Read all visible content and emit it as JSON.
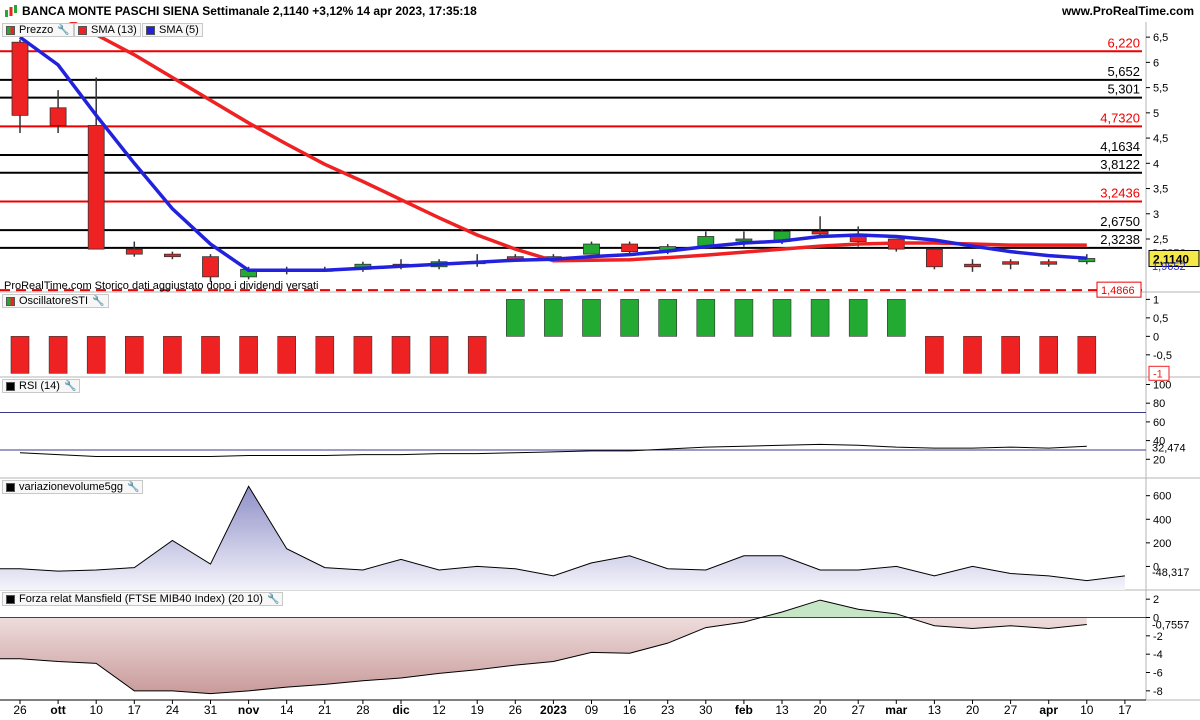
{
  "header": {
    "title": "BANCA MONTE PASCHI SIENA Settimanale 2,1140 +3,12% 14 apr 2023, 17:35:18",
    "site": "www.ProRealTime.com"
  },
  "legend_price": {
    "price_label": "Prezzo",
    "sma13_label": "SMA (13)",
    "sma5_label": "SMA (5)"
  },
  "note": "ProRealTime.com  Storico dati aggiustato dopo i dividendi versati",
  "colors": {
    "up": "#22aa33",
    "down": "#ee2222",
    "sma13": "#ee2222",
    "sma5": "#2222dd",
    "level_red": "#ee0000",
    "level_black": "#000000",
    "rsi_line": "#000000",
    "vol_fill": "#c9c9e6",
    "mansfield_pos": "#c6e6c6",
    "mansfield_neg": "#e8c8c8"
  },
  "chart_data": [
    {
      "type": "candlestick",
      "panel": "price",
      "x": [
        "26",
        "ott",
        "10",
        "17",
        "24",
        "31",
        "nov",
        "14",
        "21",
        "28",
        "dic",
        "12",
        "19",
        "26",
        "2023",
        "09",
        "16",
        "23",
        "30",
        "feb",
        "13",
        "20",
        "27",
        "mar",
        "13",
        "20",
        "27",
        "apr",
        "10",
        "17"
      ],
      "ohlc": [
        [
          6.4,
          6.45,
          4.6,
          4.95
        ],
        [
          5.1,
          5.45,
          4.6,
          4.75
        ],
        [
          4.75,
          5.7,
          2.3,
          2.3
        ],
        [
          2.3,
          2.45,
          2.15,
          2.2
        ],
        [
          2.2,
          2.25,
          2.1,
          2.15
        ],
        [
          2.15,
          2.2,
          1.65,
          1.75
        ],
        [
          1.75,
          1.95,
          1.7,
          1.9
        ],
        [
          1.9,
          1.95,
          1.8,
          1.9
        ],
        [
          1.9,
          1.95,
          1.85,
          1.9
        ],
        [
          1.9,
          2.05,
          1.85,
          2.0
        ],
        [
          2.0,
          2.1,
          1.9,
          1.95
        ],
        [
          1.95,
          2.1,
          1.9,
          2.05
        ],
        [
          2.05,
          2.2,
          1.95,
          2.05
        ],
        [
          2.15,
          2.2,
          2.05,
          2.1
        ],
        [
          2.1,
          2.2,
          2.05,
          2.15
        ],
        [
          2.2,
          2.45,
          2.2,
          2.4
        ],
        [
          2.4,
          2.45,
          2.2,
          2.25
        ],
        [
          2.25,
          2.4,
          2.2,
          2.35
        ],
        [
          2.35,
          2.65,
          2.3,
          2.55
        ],
        [
          2.5,
          2.65,
          2.35,
          2.5
        ],
        [
          2.45,
          2.7,
          2.4,
          2.65
        ],
        [
          2.65,
          2.95,
          2.55,
          2.6
        ],
        [
          2.6,
          2.75,
          2.35,
          2.45
        ],
        [
          2.5,
          2.5,
          2.25,
          2.3
        ],
        [
          2.3,
          2.3,
          1.9,
          1.95
        ],
        [
          2.0,
          2.1,
          1.85,
          1.95
        ],
        [
          2.05,
          2.1,
          1.9,
          2.0
        ],
        [
          2.05,
          2.1,
          1.95,
          2.0
        ],
        [
          2.05,
          2.2,
          2.0,
          2.114
        ],
        null
      ],
      "sma13": [
        7.4,
        6.95,
        6.55,
        6.15,
        5.7,
        5.25,
        4.8,
        4.38,
        3.98,
        3.64,
        3.28,
        2.92,
        2.58,
        2.3,
        2.07,
        2.08,
        2.09,
        2.13,
        2.18,
        2.24,
        2.3,
        2.36,
        2.4,
        2.42,
        2.42,
        2.4,
        2.38,
        2.38,
        2.38,
        null
      ],
      "sma5": [
        6.5,
        5.95,
        4.95,
        4.0,
        3.1,
        2.4,
        1.88,
        1.88,
        1.88,
        1.92,
        1.96,
        2.0,
        2.04,
        2.08,
        2.1,
        2.15,
        2.19,
        2.26,
        2.35,
        2.42,
        2.46,
        2.55,
        2.58,
        2.55,
        2.48,
        2.36,
        2.25,
        2.17,
        2.12,
        null
      ],
      "levels": [
        {
          "value": 6.22,
          "label": "6,220",
          "color": "red"
        },
        {
          "value": 5.652,
          "label": "5,652",
          "color": "black"
        },
        {
          "value": 5.301,
          "label": "5,301",
          "color": "black"
        },
        {
          "value": 4.732,
          "label": "4,7320",
          "color": "red"
        },
        {
          "value": 4.1634,
          "label": "4,1634",
          "color": "black"
        },
        {
          "value": 3.8122,
          "label": "3,8122",
          "color": "black"
        },
        {
          "value": 3.2436,
          "label": "3,2436",
          "color": "red"
        },
        {
          "value": 2.675,
          "label": "2,6750",
          "color": "black"
        },
        {
          "value": 2.3238,
          "label": "2,3238",
          "color": "black"
        },
        {
          "value": 1.4866,
          "label": "1,4866",
          "color": "red",
          "dashed": true
        }
      ],
      "y_ticks": [
        "6,5",
        "6",
        "5,5",
        "5",
        "4,5",
        "4",
        "3,5",
        "3",
        "2,5"
      ],
      "y_tick_values": [
        6.5,
        6,
        5.5,
        5,
        4.5,
        4,
        3.5,
        3,
        2.5
      ],
      "ylim": [
        1.45,
        6.8
      ],
      "tags": [
        {
          "value": 2.2356,
          "label": "2,2356",
          "color": "#ee2222"
        },
        {
          "value": 2.114,
          "label": "2,1140",
          "color": "#000000",
          "highlight": true
        },
        {
          "value": 1.9652,
          "label": "1,9652",
          "color": "#2222dd"
        }
      ]
    },
    {
      "type": "bar",
      "panel": "sti",
      "title": "OscillatoreSTI",
      "values": [
        -1,
        -1,
        -1,
        -1,
        -1,
        -1,
        -1,
        -1,
        -1,
        -1,
        -1,
        -1,
        -1,
        1,
        1,
        1,
        1,
        1,
        1,
        1,
        1,
        1,
        1,
        1,
        -1,
        -1,
        -1,
        -1,
        -1,
        null
      ],
      "ylim": [
        -1.1,
        1.2
      ],
      "y_ticks": [
        "1",
        "0,5",
        "0",
        "-0,5"
      ],
      "y_tick_values": [
        1,
        0.5,
        0,
        -0.5
      ],
      "tag": {
        "value": -1,
        "label": "-1"
      }
    },
    {
      "type": "line",
      "panel": "rsi",
      "title": "RSI (14)",
      "values": [
        27,
        25,
        23,
        23,
        23,
        23,
        24,
        24,
        24,
        25,
        25,
        26,
        26,
        27,
        28,
        29,
        29,
        31,
        33,
        34,
        35,
        36,
        35,
        33,
        32,
        32,
        33,
        32,
        34,
        null
      ],
      "ylim": [
        0,
        108
      ],
      "hlines": [
        70,
        30
      ],
      "y_ticks": [
        "100",
        "80",
        "60",
        "40",
        "20"
      ],
      "y_tick_values": [
        100,
        80,
        60,
        40,
        20
      ],
      "tag": {
        "value": 32.474,
        "label": "32,474"
      }
    },
    {
      "type": "area",
      "panel": "volume",
      "title": "variazionevolume5gg",
      "values": [
        -20,
        -40,
        -30,
        -10,
        220,
        20,
        680,
        150,
        -10,
        -30,
        60,
        -30,
        0,
        -20,
        -80,
        30,
        90,
        -20,
        -30,
        90,
        90,
        -30,
        -30,
        0,
        -80,
        0,
        -60,
        -80,
        -120,
        -80,
        null
      ],
      "ylim": [
        -200,
        750
      ],
      "y_ticks": [
        "600",
        "400",
        "200",
        "0"
      ],
      "y_tick_values": [
        600,
        400,
        200,
        0
      ],
      "tag": {
        "value": -48.317,
        "label": "-48,317"
      }
    },
    {
      "type": "area",
      "panel": "mansfield",
      "title": "Forza relat Mansfield (FTSE MIB40 Index) (20 10)",
      "values": [
        -4.5,
        -4.8,
        -5.0,
        -8.0,
        -8.0,
        -8.3,
        -8.0,
        -7.6,
        -7.3,
        -6.9,
        -6.6,
        -6.1,
        -5.7,
        -5.2,
        -4.8,
        -3.8,
        -3.9,
        -2.8,
        -1.1,
        -0.5,
        0.6,
        1.9,
        0.9,
        0.4,
        -0.9,
        -1.2,
        -0.9,
        -1.2,
        -0.76,
        null
      ],
      "ylim": [
        -9,
        3
      ],
      "y_ticks": [
        "2",
        "0",
        "-2",
        "-4",
        "-6",
        "-8"
      ],
      "y_tick_values": [
        2,
        0,
        -2,
        -4,
        -6,
        -8
      ],
      "tag": {
        "value": -0.7557,
        "label": "-0,7557"
      }
    }
  ],
  "x_labels": [
    "26",
    "ott",
    "10",
    "17",
    "24",
    "31",
    "nov",
    "14",
    "21",
    "28",
    "dic",
    "12",
    "19",
    "26",
    "2023",
    "09",
    "16",
    "23",
    "30",
    "feb",
    "13",
    "20",
    "27",
    "mar",
    "13",
    "20",
    "27",
    "apr",
    "10",
    "17"
  ],
  "x_bold": [
    "ott",
    "nov",
    "dic",
    "2023",
    "feb",
    "mar",
    "apr"
  ]
}
